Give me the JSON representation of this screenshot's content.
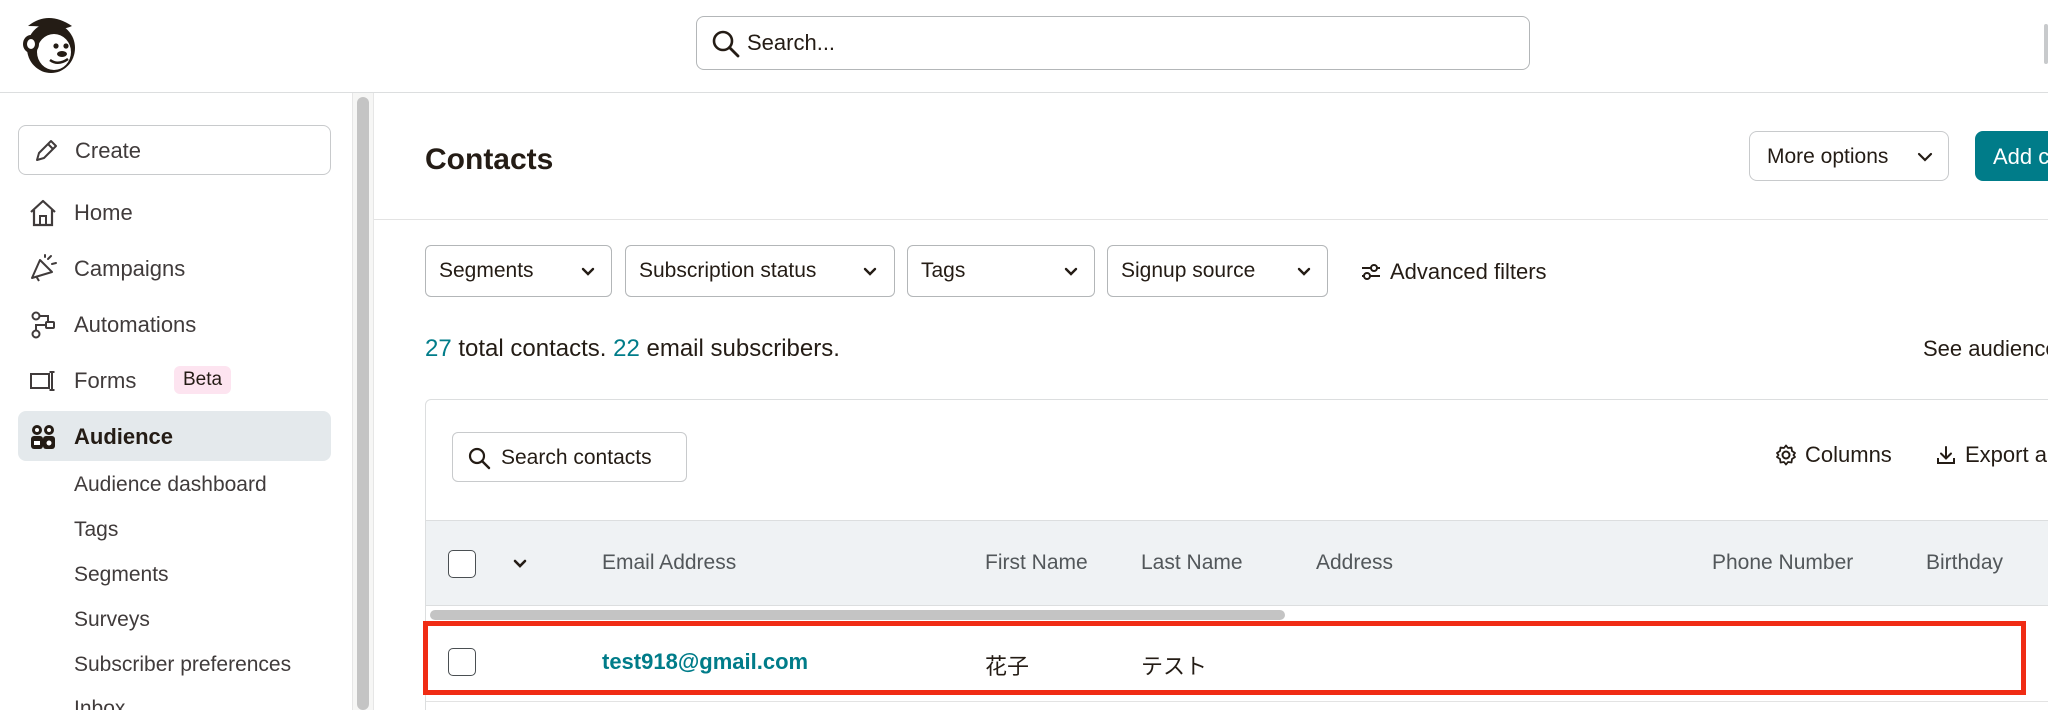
{
  "topbar": {
    "search_placeholder": "Search..."
  },
  "sidebar": {
    "create_label": "Create",
    "nav": [
      {
        "label": "Home",
        "icon": "home-icon"
      },
      {
        "label": "Campaigns",
        "icon": "megaphone-icon"
      },
      {
        "label": "Automations",
        "icon": "automation-flow-icon"
      },
      {
        "label": "Forms",
        "icon": "form-icon",
        "badge": "Beta"
      },
      {
        "label": "Audience",
        "icon": "audience-icon",
        "active": true
      }
    ],
    "audience_sub": [
      "Audience dashboard",
      "Tags",
      "Segments",
      "Surveys",
      "Subscriber preferences",
      "Inbox"
    ]
  },
  "main": {
    "title": "Contacts",
    "more_options_label": "More options",
    "add_button_label": "Add contacts",
    "filters": [
      "Segments",
      "Subscription status",
      "Tags",
      "Signup source"
    ],
    "advanced_filters_label": "Advanced filters",
    "summary": {
      "total": "27",
      "total_text": " total contacts. ",
      "subscribers": "22",
      "subscribers_text": " email subscribers."
    },
    "see_audience_label": "See audience",
    "search_contacts_label": "Search contacts",
    "columns_label": "Columns",
    "export_label": "Export audience",
    "table": {
      "headers": [
        "Email Address",
        "First Name",
        "Last Name",
        "Address",
        "Phone Number",
        "Birthday"
      ],
      "rows": [
        {
          "email": "test918@gmail.com",
          "first_name": "花子",
          "last_name": "テスト",
          "address": "",
          "phone": "",
          "birthday": ""
        }
      ]
    }
  },
  "colors": {
    "accent_teal": "#007c89",
    "highlight_red": "#f02c14",
    "active_nav_bg": "#e4e9ec",
    "beta_badge_bg": "#fde4f0"
  }
}
